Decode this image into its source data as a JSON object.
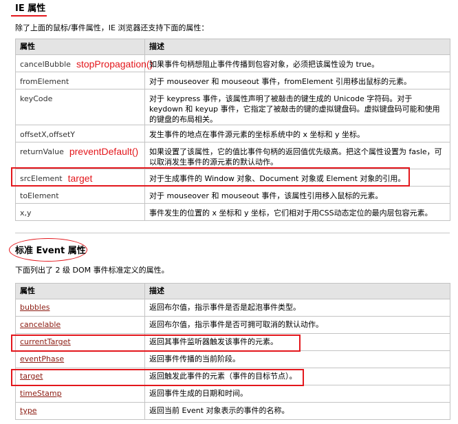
{
  "ie_section": {
    "title": "IE 属性",
    "intro": "除了上面的鼠标/事件属性，IE 浏览器还支持下面的属性：",
    "col_property": "属性",
    "col_description": "描述",
    "rows": [
      {
        "name": "cancelBubble",
        "note": "stopPropagation()",
        "desc": "如果事件句柄想阻止事件传播到包容对象，必须把该属性设为 true。"
      },
      {
        "name": "fromElement",
        "note": "",
        "desc": "对于 mouseover 和 mouseout 事件，fromElement 引用移出鼠标的元素。"
      },
      {
        "name": "keyCode",
        "note": "",
        "desc": "对于 keypress 事件，该属性声明了被敲击的键生成的 Unicode 字符码。对于 keydown 和 keyup 事件，它指定了被敲击的键的虚拟键盘码。虚拟键盘码可能和使用的键盘的布局相关。"
      },
      {
        "name": "offsetX,offsetY",
        "note": "",
        "desc": "发生事件的地点在事件源元素的坐标系统中的 x 坐标和 y 坐标。"
      },
      {
        "name": "returnValue",
        "note": "preventDefault()",
        "desc": "如果设置了该属性，它的值比事件句柄的返回值优先级高。把这个属性设置为 fasle，可以取消发生事件的源元素的默认动作。"
      },
      {
        "name": "srcElement",
        "note": "target",
        "desc": "对于生成事件的 Window 对象、Document 对象或 Element 对象的引用。"
      },
      {
        "name": "toElement",
        "note": "",
        "desc": "对于 mouseover 和 mouseout 事件，该属性引用移入鼠标的元素。"
      },
      {
        "name": "x,y",
        "note": "",
        "desc": "事件发生的位置的 x 坐标和 y 坐标，它们相对于用CSS动态定位的最内层包容元素。"
      }
    ]
  },
  "std_section": {
    "title": "标准 Event 属性",
    "intro": "下面列出了 2 级 DOM 事件标准定义的属性。",
    "col_property": "属性",
    "col_description": "描述",
    "rows": [
      {
        "name": "bubbles",
        "desc": "返回布尔值，指示事件是否是起泡事件类型。"
      },
      {
        "name": "cancelable",
        "desc": "返回布尔值，指示事件是否可拥可取消的默认动作。"
      },
      {
        "name": "currentTarget",
        "desc": "返回其事件监听器触发该事件的元素。"
      },
      {
        "name": "eventPhase",
        "desc": "返回事件传播的当前阶段。"
      },
      {
        "name": "target",
        "desc": "返回触发此事件的元素（事件的目标节点）。"
      },
      {
        "name": "timeStamp",
        "desc": "返回事件生成的日期和时间。"
      },
      {
        "name": "type",
        "desc": "返回当前 Event 对象表示的事件的名称。"
      }
    ]
  },
  "colors": {
    "annotation_red": "#e3161b",
    "link": "#8b1a10",
    "header_bg": "#e4e4e4"
  }
}
